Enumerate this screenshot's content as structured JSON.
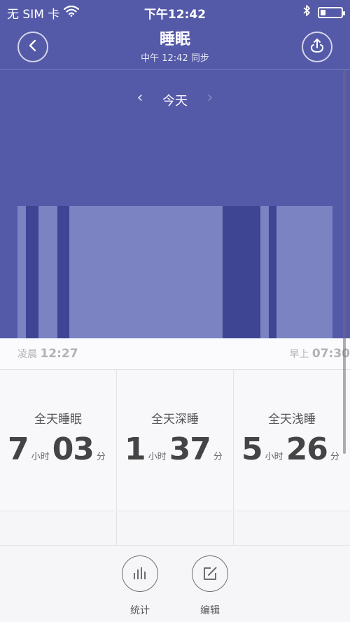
{
  "status_bar": {
    "carrier": "无 SIM 卡",
    "time": "下午12:42"
  },
  "header": {
    "title": "睡眠",
    "subtitle": "中午 12:42 同步"
  },
  "date_nav": {
    "label": "今天"
  },
  "chart_data": {
    "type": "bar",
    "title": "",
    "x_start": "12:27",
    "x_end": "07:30",
    "legend": [],
    "segments": [
      {
        "stage": "light",
        "color": "#7b83c2",
        "span": [
          0.0,
          0.027
        ]
      },
      {
        "stage": "deep",
        "color": "#3e4592",
        "span": [
          0.027,
          0.067
        ]
      },
      {
        "stage": "light",
        "color": "#7b83c2",
        "span": [
          0.067,
          0.127
        ]
      },
      {
        "stage": "deep",
        "color": "#3e4592",
        "span": [
          0.127,
          0.164
        ]
      },
      {
        "stage": "light",
        "color": "#7b83c2",
        "span": [
          0.164,
          0.651
        ]
      },
      {
        "stage": "deep",
        "color": "#3e4592",
        "span": [
          0.651,
          0.771
        ]
      },
      {
        "stage": "light",
        "color": "#7b83c2",
        "span": [
          0.771,
          0.798
        ]
      },
      {
        "stage": "deep",
        "color": "#3e4592",
        "span": [
          0.798,
          0.822
        ]
      },
      {
        "stage": "light",
        "color": "#7b83c2",
        "span": [
          0.822,
          1.0
        ]
      }
    ]
  },
  "time_range": {
    "start_prefix": "凌晨",
    "start_time": "12:27",
    "end_prefix": "早上",
    "end_time": "07:30"
  },
  "stats": [
    {
      "label": "全天睡眠",
      "hours": "7",
      "hour_unit": "小时",
      "minutes": "03",
      "minute_unit": "分"
    },
    {
      "label": "全天深睡",
      "hours": "1",
      "hour_unit": "小时",
      "minutes": "37",
      "minute_unit": "分"
    },
    {
      "label": "全天浅睡",
      "hours": "5",
      "hour_unit": "小时",
      "minutes": "26",
      "minute_unit": "分"
    }
  ],
  "toolbar": {
    "stats_label": "统计",
    "edit_label": "编辑"
  },
  "colors": {
    "header_bg": "#5459a8",
    "light_sleep": "#7b83c2",
    "deep_sleep": "#3e4592"
  },
  "icons": [
    "wifi-icon",
    "bluetooth-icon",
    "battery-icon",
    "back-icon",
    "share-icon",
    "bar-chart-icon",
    "edit-icon"
  ]
}
